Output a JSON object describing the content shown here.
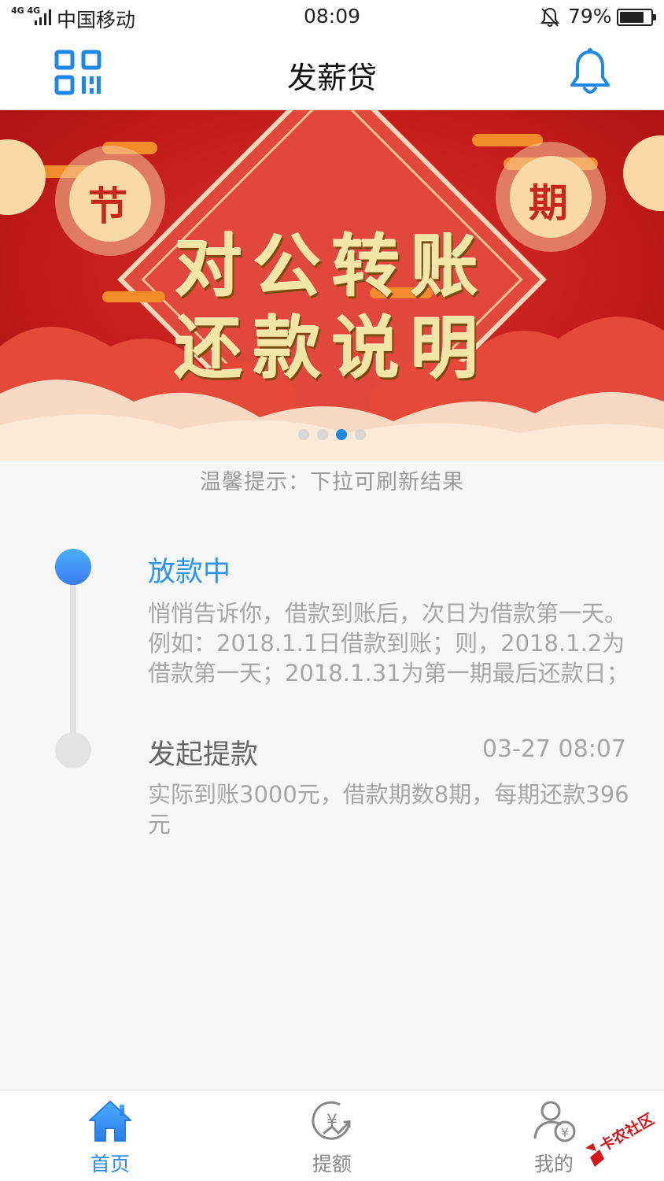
{
  "status_bar": {
    "network": "4G 4G",
    "carrier": "中国移动",
    "time": "08:09",
    "battery_percent": "79%",
    "battery_level": 0.79
  },
  "header": {
    "title": "发薪贷",
    "left_icon": "qr-scan-icon",
    "right_icon": "bell-icon",
    "accent_color": "#1e88e5"
  },
  "banner": {
    "line1": "对公转账",
    "line2": "还款说明",
    "lantern_left": "节",
    "lantern_right": "期",
    "slide_count": 4,
    "active_slide": 3
  },
  "tip": "温馨提示：下拉可刷新结果",
  "timeline": [
    {
      "title": "放款中",
      "description": "悄悄告诉你，借款到账后，次日为借款第一天。例如：2018.1.1日借款到账；则，2018.1.2为借款第一天；2018.1.31为第一期最后还款日；",
      "time": "",
      "active": true
    },
    {
      "title": "发起提款",
      "description": "实际到账3000元，借款期数8期，每期还款396元",
      "time": "03-27 08:07",
      "active": false
    }
  ],
  "tabbar": {
    "items": [
      {
        "label": "首页",
        "icon": "home-icon",
        "active": true
      },
      {
        "label": "提额",
        "icon": "credit-limit-icon",
        "active": false
      },
      {
        "label": "我的",
        "icon": "profile-icon",
        "active": false
      }
    ]
  },
  "watermark": "卡农社区"
}
